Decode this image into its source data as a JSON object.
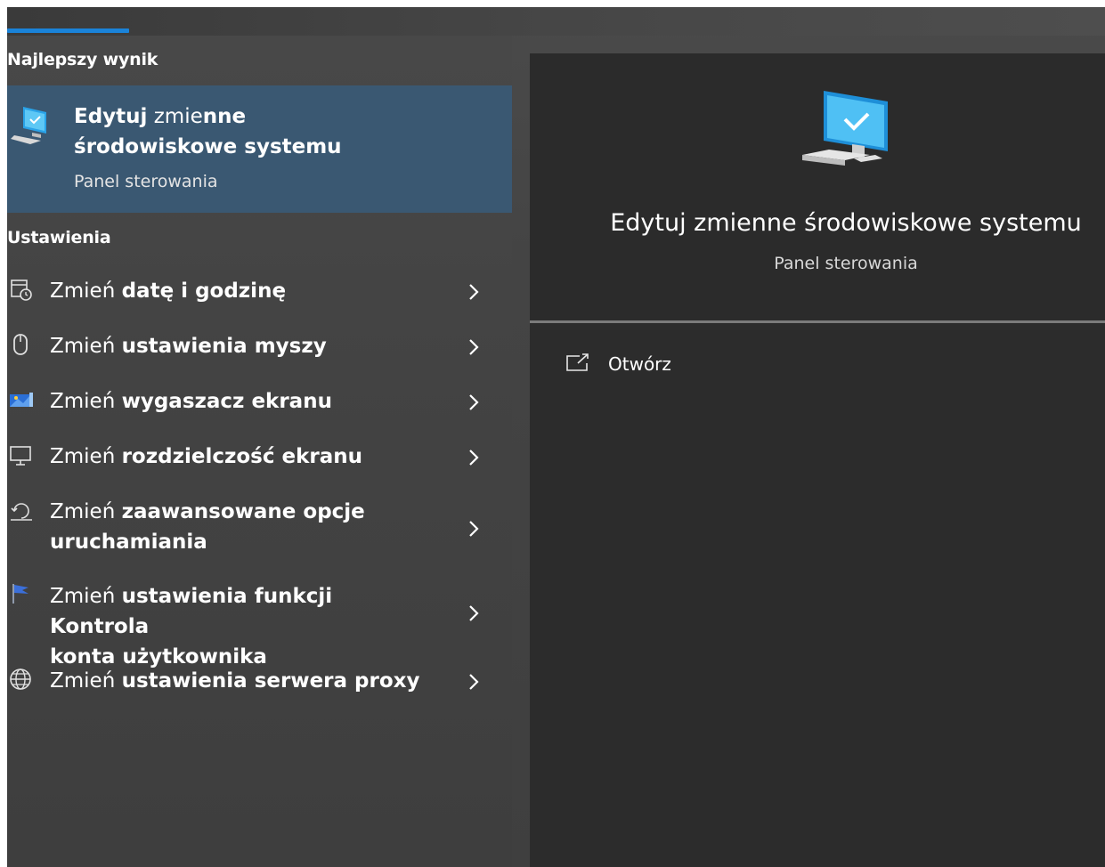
{
  "best_match": {
    "header": "Najlepszy wynik",
    "title_bold_1": "Edytuj",
    "title_light": " zmie",
    "title_bold_2": "nne",
    "title_line2": "środowiskowe systemu",
    "subtitle": "Panel sterowania",
    "icon": "computer-checkmark-icon"
  },
  "settings": {
    "header": "Ustawienia",
    "items": [
      {
        "prefix": "Zmień ",
        "rest": "datę i godzinę",
        "icon": "calendar-clock-icon"
      },
      {
        "prefix": "Zmień ",
        "rest": "ustawienia myszy",
        "icon": "mouse-icon"
      },
      {
        "prefix": "Zmień ",
        "rest": "wygaszacz ekranu",
        "icon": "screensaver-icon"
      },
      {
        "prefix": "Zmień ",
        "rest": "rozdzielczość ekranu",
        "icon": "monitor-icon"
      },
      {
        "prefix": "Zmień ",
        "rest": "zaawansowane opcje",
        "line2": "uruchamiania",
        "icon": "recovery-icon"
      },
      {
        "prefix": "Zmień ",
        "rest": "ustawienia funkcji Kontrola",
        "line2": "konta użytkownika",
        "icon": "flag-icon"
      },
      {
        "prefix": "Zmień ",
        "rest": "ustawienia serwera proxy",
        "icon": "globe-icon"
      }
    ]
  },
  "preview": {
    "title": "Edytuj zmienne środowiskowe systemu",
    "subtitle": "Panel sterowania",
    "actions": [
      {
        "label": "Otwórz",
        "icon": "open-external-icon"
      }
    ]
  },
  "colors": {
    "accent": "#1a83d9",
    "selected": "#3a5872",
    "panel": "#2c2c2c"
  }
}
